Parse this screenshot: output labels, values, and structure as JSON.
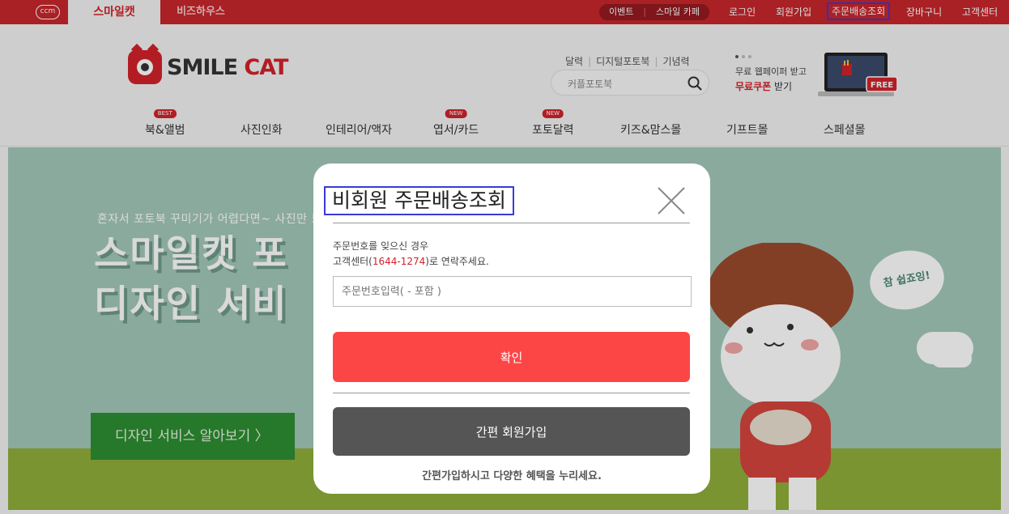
{
  "topbar": {
    "ccm_label": "ccm",
    "tabs": [
      {
        "label": "스마일캣"
      },
      {
        "label": "비즈하우스"
      }
    ],
    "pill_links": [
      {
        "label": "이벤트"
      },
      {
        "label": "스마일 카페"
      }
    ],
    "links": [
      {
        "label": "로그인"
      },
      {
        "label": "회원가입"
      },
      {
        "label": "주문배송조회"
      },
      {
        "label": "장바구니"
      },
      {
        "label": "고객센터"
      }
    ]
  },
  "header": {
    "logo": {
      "smile": "SMILE",
      "cat": "CAT"
    },
    "quick_links": [
      {
        "label": "달력"
      },
      {
        "label": "디지털포토북"
      },
      {
        "label": "기념력"
      }
    ],
    "search": {
      "placeholder": "커플포토북"
    },
    "promo": {
      "line1": "무료 웹페이퍼 받고",
      "highlight": "무료쿠폰",
      "suffix": " 받기",
      "badge": "FREE"
    }
  },
  "nav": {
    "items": [
      {
        "label": "북&앨범",
        "badge": "BEST"
      },
      {
        "label": "사진인화",
        "badge": ""
      },
      {
        "label": "인테리어/액자",
        "badge": ""
      },
      {
        "label": "엽서/카드",
        "badge": "NEW"
      },
      {
        "label": "포토달력",
        "badge": "NEW"
      },
      {
        "label": "키즈&맘스몰",
        "badge": ""
      },
      {
        "label": "기프트몰",
        "badge": ""
      },
      {
        "label": "스페셜몰",
        "badge": ""
      }
    ]
  },
  "banner": {
    "subtitle": "혼자서 포토북 꾸미기가 어렵다면~ 사진만 보",
    "title_line1": "스마일캣 포",
    "title_line2": "디자인 서비",
    "button_label": "디자인 서비스 알아보기 〉",
    "bubble": "참 쉽죠잉!"
  },
  "modal": {
    "title": "비회원 주문배송조회",
    "info_line1": "주문번호를 잊으신 경우",
    "info_line2_prefix": "고객센터(",
    "phone": "1644-1274",
    "info_line2_suffix": ")로 연락주세요.",
    "order_input_placeholder": "주문번호입력( - 포함 )",
    "order_input_value": "",
    "confirm_label": "확인",
    "join_label": "간편 회원가입",
    "footer_text": "간편가입하시고 다양한 혜택을 누리세요."
  },
  "colors": {
    "brand_red": "#d2232a",
    "confirm_button": "#fc4646",
    "join_button": "#555555",
    "highlight_border": "#3a3ad6"
  }
}
